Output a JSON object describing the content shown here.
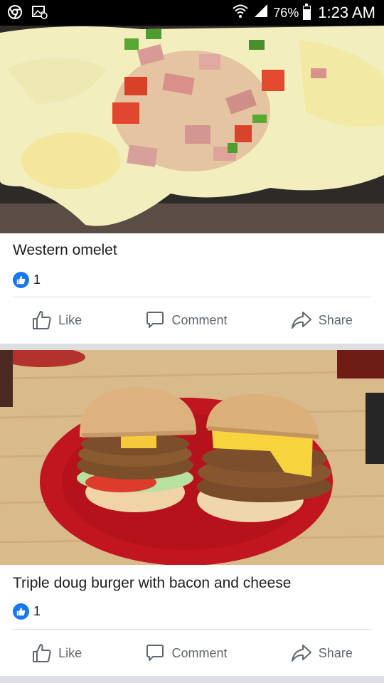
{
  "status_bar": {
    "battery_percent": "76%",
    "battery_level": 0.76,
    "time": "1:23 AM"
  },
  "posts": [
    {
      "caption": "Western omelet",
      "reaction_count": "1",
      "actions": {
        "like": "Like",
        "comment": "Comment",
        "share": "Share"
      }
    },
    {
      "caption": "Triple doug burger with bacon and cheese",
      "reaction_count": "1",
      "actions": {
        "like": "Like",
        "comment": "Comment",
        "share": "Share"
      }
    }
  ],
  "colors": {
    "reaction_blue": "#1877f2",
    "action_gray": "#606770",
    "text": "#1c1e21"
  }
}
